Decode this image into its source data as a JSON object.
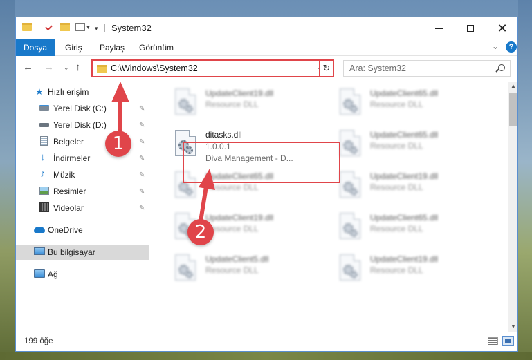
{
  "window": {
    "title": "System32",
    "minimize_icon": "minimize-icon",
    "maximize_icon": "maximize-icon",
    "close_glyph": "✕"
  },
  "ribbon": {
    "tabs": [
      "Dosya",
      "Giriş",
      "Paylaş",
      "Görünüm"
    ],
    "expand_glyph": "⌄",
    "help_glyph": "?"
  },
  "nav": {
    "back_glyph": "←",
    "forward_glyph": "→",
    "recent_glyph": "⌄",
    "up_glyph": "↑",
    "address": "C:\\Windows\\System32",
    "address_dropdown_glyph": "⌄",
    "refresh_glyph": "↻",
    "search_placeholder": "Ara: System32"
  },
  "sidebar": {
    "items": [
      {
        "label": "Hızlı erişim",
        "icon": "star-icon",
        "pinned": false
      },
      {
        "label": "Yerel Disk (C:)",
        "icon": "drive-c-icon",
        "pinned": true
      },
      {
        "label": "Yerel Disk (D:)",
        "icon": "drive-d-icon",
        "pinned": true
      },
      {
        "label": "Belgeler",
        "icon": "documents-icon",
        "pinned": true
      },
      {
        "label": "İndirmeler",
        "icon": "downloads-icon",
        "pinned": true
      },
      {
        "label": "Müzik",
        "icon": "music-icon",
        "pinned": true
      },
      {
        "label": "Resimler",
        "icon": "pictures-icon",
        "pinned": true
      },
      {
        "label": "Videolar",
        "icon": "videos-icon",
        "pinned": true
      },
      {
        "label": "OneDrive",
        "icon": "onedrive-icon",
        "pinned": false
      },
      {
        "label": "Bu bilgisayar",
        "icon": "this-pc-icon",
        "pinned": false,
        "selected": true
      },
      {
        "label": "Ağ",
        "icon": "network-icon",
        "pinned": false
      }
    ],
    "pin_glyph": "✎"
  },
  "files": [
    {
      "name": "UpdateClient19.dll",
      "sub1": "Resource DLL",
      "blurred": true
    },
    {
      "name": "UpdateClient65.dll",
      "sub1": "Resource DLL",
      "blurred": true
    },
    {
      "name": "ditasks.dll",
      "sub1": "1.0.0.1",
      "sub2": "Diva Management - D...",
      "blurred": false
    },
    {
      "name": "UpdateClient65.dll",
      "sub1": "Resource DLL",
      "blurred": true
    },
    {
      "name": "UpdateClient65.dll",
      "sub1": "Resource DLL",
      "blurred": true
    },
    {
      "name": "UpdateClient19.dll",
      "sub1": "Resource DLL",
      "blurred": true
    },
    {
      "name": "UpdateClient19.dll",
      "sub1": "Resource DLL",
      "blurred": true
    },
    {
      "name": "UpdateClient65.dll",
      "sub1": "Resource DLL",
      "blurred": true
    },
    {
      "name": "UpdateClient5.dll",
      "sub1": "Resource DLL",
      "blurred": true
    },
    {
      "name": "UpdateClient19.dll",
      "sub1": "Resource DLL",
      "blurred": true
    }
  ],
  "status": {
    "item_count": "199 öğe"
  },
  "scroll": {
    "up_glyph": "▲",
    "down_glyph": "▼"
  },
  "annotations": {
    "badge_1": "1",
    "badge_2": "2",
    "color": "#e0454a"
  },
  "colors": {
    "accent": "#1979ca",
    "highlight": "#e0454a"
  }
}
